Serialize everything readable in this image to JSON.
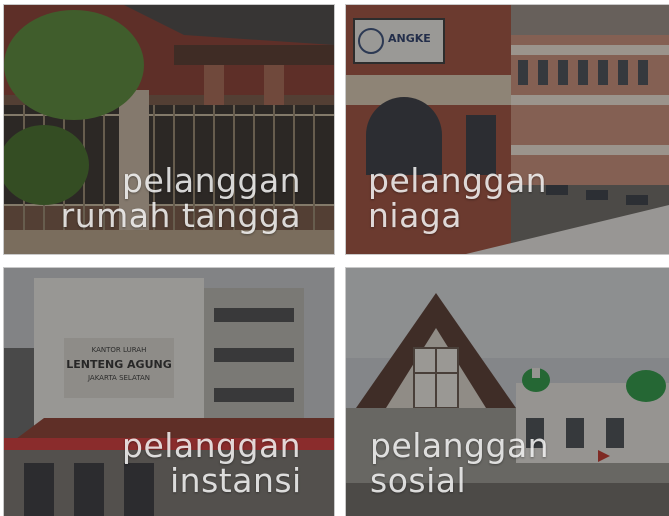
{
  "tiles": [
    {
      "id": "rumah-tangga",
      "line1": "pelanggan",
      "line2": "rumah tangga"
    },
    {
      "id": "niaga",
      "line1": "pelanggan",
      "line2": "niaga",
      "sign": "ANGKE"
    },
    {
      "id": "instansi",
      "line1": "pelanggan",
      "line2": "instansi",
      "sign_line1": "KANTOR LURAH",
      "sign_line2": "LENTENG AGUNG",
      "sign_line3": "JAKARTA SELATAN"
    },
    {
      "id": "sosial",
      "line1": "pelanggan",
      "line2": "sosial"
    }
  ]
}
